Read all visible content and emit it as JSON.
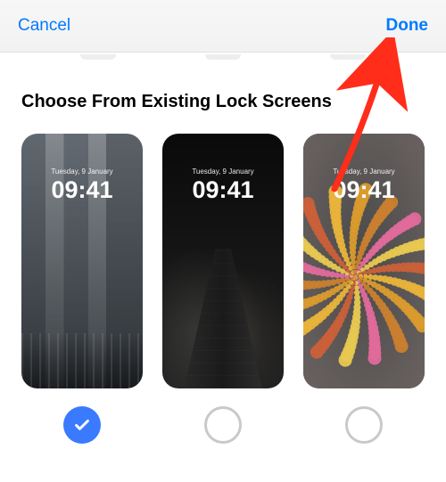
{
  "header": {
    "cancel_label": "Cancel",
    "done_label": "Done"
  },
  "section_title": "Choose From Existing Lock Screens",
  "lockscreen_preview": {
    "date": "Tuesday, 9 January",
    "time": "09:41"
  },
  "wallpapers": [
    {
      "name": "city-rain",
      "selected": true
    },
    {
      "name": "dark-street",
      "selected": false
    },
    {
      "name": "emoji-spiral",
      "selected": false
    }
  ],
  "colors": {
    "accent": "#007aff",
    "selection": "#3a7afe",
    "callout_arrow": "#ff2d1a"
  }
}
